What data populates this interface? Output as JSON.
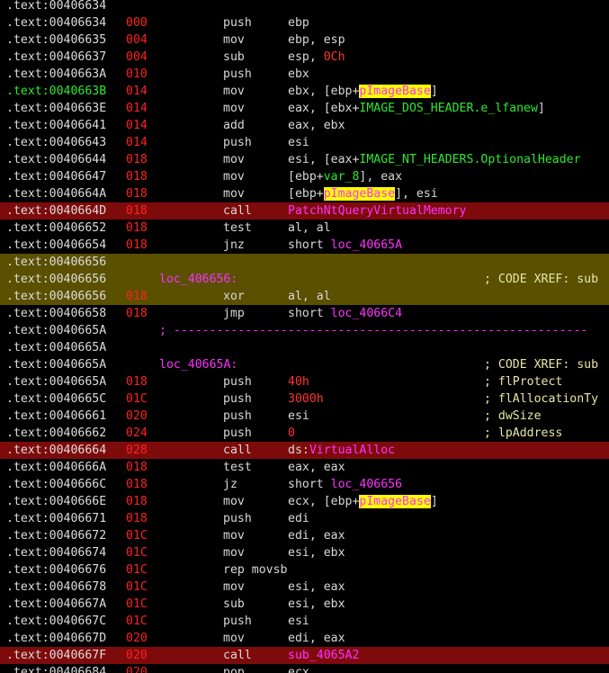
{
  "colors": {
    "background": "#000000",
    "call_highlight": "#7e0b0b",
    "selection_highlight": "#5a5000",
    "address_text": "#dcdcdc",
    "address_green": "#2ee82e",
    "stack_pointer": "#ff2020",
    "name_magenta": "#ff30ff",
    "comment_text": "#e6e6a6",
    "symbol_highlight": "#ffff00"
  },
  "lines": [
    {
      "addr": ".text:00406634",
      "sp": "",
      "mn": "",
      "opd": [],
      "comment": ""
    },
    {
      "addr": ".text:00406634",
      "sp": "000",
      "mn": "push",
      "opd": [
        [
          "ebp",
          ""
        ]
      ],
      "comment": ""
    },
    {
      "addr": ".text:00406635",
      "sp": "004",
      "mn": "mov",
      "opd": [
        [
          "ebp, esp",
          ""
        ]
      ],
      "comment": ""
    },
    {
      "addr": ".text:00406637",
      "sp": "004",
      "mn": "sub",
      "opd": [
        [
          "esp, ",
          ""
        ],
        [
          "0Ch",
          "num"
        ]
      ],
      "comment": ""
    },
    {
      "addr": ".text:0040663A",
      "sp": "010",
      "mn": "push",
      "opd": [
        [
          "ebx",
          ""
        ]
      ],
      "comment": ""
    },
    {
      "addr": ".text:0040663B",
      "addr_green": true,
      "sp": "014",
      "mn": "mov",
      "opd": [
        [
          "ebx, [ebp+",
          ""
        ],
        [
          "pImageBase",
          "hl"
        ],
        [
          "]",
          ""
        ]
      ],
      "comment": ""
    },
    {
      "addr": ".text:0040663E",
      "sp": "014",
      "mn": "mov",
      "opd": [
        [
          "eax, [ebx+",
          ""
        ],
        [
          "IMAGE_DOS_HEADER.e_lfanew",
          "grn"
        ],
        [
          "]",
          ""
        ]
      ],
      "comment": ""
    },
    {
      "addr": ".text:00406641",
      "sp": "014",
      "mn": "add",
      "opd": [
        [
          "eax, ebx",
          ""
        ]
      ],
      "comment": ""
    },
    {
      "addr": ".text:00406643",
      "sp": "014",
      "mn": "push",
      "opd": [
        [
          "esi",
          ""
        ]
      ],
      "comment": ""
    },
    {
      "addr": ".text:00406644",
      "sp": "018",
      "mn": "mov",
      "opd": [
        [
          "esi, [eax+",
          ""
        ],
        [
          "IMAGE_NT_HEADERS.OptionalHeader",
          "grn"
        ]
      ],
      "comment": ""
    },
    {
      "addr": ".text:00406647",
      "sp": "018",
      "mn": "mov",
      "opd": [
        [
          "[ebp+",
          ""
        ],
        [
          "var_8",
          "grn"
        ],
        [
          "], eax",
          ""
        ]
      ],
      "comment": ""
    },
    {
      "addr": ".text:0040664A",
      "sp": "018",
      "mn": "mov",
      "opd": [
        [
          "[ebp+",
          ""
        ],
        [
          "pImageBase",
          "hl"
        ],
        [
          "], esi",
          ""
        ]
      ],
      "comment": ""
    },
    {
      "addr": ".text:0040664D",
      "sp": "018",
      "mn": "call",
      "opd": [
        [
          "PatchNtQueryVirtualMemory",
          "name"
        ]
      ],
      "comment": "",
      "style": "call"
    },
    {
      "addr": ".text:00406652",
      "sp": "018",
      "mn": "test",
      "opd": [
        [
          "al, al",
          ""
        ]
      ],
      "comment": ""
    },
    {
      "addr": ".text:00406654",
      "sp": "018",
      "mn": "jnz",
      "opd": [
        [
          "short ",
          ""
        ],
        [
          "loc_40665A",
          "name"
        ]
      ],
      "comment": ""
    },
    {
      "addr": ".text:00406656",
      "sp": "",
      "mn": "",
      "opd": [],
      "comment": "",
      "style": "yellow"
    },
    {
      "addr": ".text:00406656",
      "sp": "",
      "mn": "",
      "opd": [],
      "label": "loc_406656:",
      "comment": "; CODE XREF: sub",
      "style": "yellow"
    },
    {
      "addr": ".text:00406656",
      "sp": "018",
      "mn": "xor",
      "opd": [
        [
          "al, al",
          ""
        ]
      ],
      "comment": "",
      "style": "yellow"
    },
    {
      "addr": ".text:00406658",
      "sp": "018",
      "mn": "jmp",
      "opd": [
        [
          "short ",
          ""
        ],
        [
          "loc_4066C4",
          "name"
        ]
      ],
      "comment": ""
    },
    {
      "addr": ".text:0040665A",
      "sp": "",
      "mn": "",
      "opd": [],
      "dashes": "; ----------------------------------------------------------",
      "comment": ""
    },
    {
      "addr": ".text:0040665A",
      "sp": "",
      "mn": "",
      "opd": [],
      "comment": ""
    },
    {
      "addr": ".text:0040665A",
      "sp": "",
      "mn": "",
      "opd": [],
      "label": "loc_40665A:",
      "comment": "; CODE XREF: sub"
    },
    {
      "addr": ".text:0040665A",
      "sp": "018",
      "mn": "push",
      "opd": [
        [
          "40h",
          "num"
        ]
      ],
      "comment": "; flProtect"
    },
    {
      "addr": ".text:0040665C",
      "sp": "01C",
      "mn": "push",
      "opd": [
        [
          "3000h",
          "num"
        ]
      ],
      "comment": "; flAllocationTy"
    },
    {
      "addr": ".text:00406661",
      "sp": "020",
      "mn": "push",
      "opd": [
        [
          "esi",
          ""
        ]
      ],
      "comment": "; dwSize"
    },
    {
      "addr": ".text:00406662",
      "sp": "024",
      "mn": "push",
      "opd": [
        [
          "0",
          "num"
        ]
      ],
      "comment": "; lpAddress"
    },
    {
      "addr": ".text:00406664",
      "sp": "028",
      "mn": "call",
      "opd": [
        [
          "ds:",
          ""
        ],
        [
          "VirtualAlloc",
          "name"
        ]
      ],
      "comment": "",
      "style": "call"
    },
    {
      "addr": ".text:0040666A",
      "sp": "018",
      "mn": "test",
      "opd": [
        [
          "eax, eax",
          ""
        ]
      ],
      "comment": ""
    },
    {
      "addr": ".text:0040666C",
      "sp": "018",
      "mn": "jz",
      "opd": [
        [
          "short ",
          ""
        ],
        [
          "loc_406656",
          "name"
        ]
      ],
      "comment": ""
    },
    {
      "addr": ".text:0040666E",
      "sp": "018",
      "mn": "mov",
      "opd": [
        [
          "ecx, [ebp+",
          ""
        ],
        [
          "pImageBase",
          "hl"
        ],
        [
          "]",
          ""
        ]
      ],
      "comment": ""
    },
    {
      "addr": ".text:00406671",
      "sp": "018",
      "mn": "push",
      "opd": [
        [
          "edi",
          ""
        ]
      ],
      "comment": ""
    },
    {
      "addr": ".text:00406672",
      "sp": "01C",
      "mn": "mov",
      "opd": [
        [
          "edi, eax",
          ""
        ]
      ],
      "comment": ""
    },
    {
      "addr": ".text:00406674",
      "sp": "01C",
      "mn": "mov",
      "opd": [
        [
          "esi, ebx",
          ""
        ]
      ],
      "comment": ""
    },
    {
      "addr": ".text:00406676",
      "sp": "01C",
      "mn": "rep movsb",
      "opd": [],
      "comment": ""
    },
    {
      "addr": ".text:00406678",
      "sp": "01C",
      "mn": "mov",
      "opd": [
        [
          "esi, eax",
          ""
        ]
      ],
      "comment": ""
    },
    {
      "addr": ".text:0040667A",
      "sp": "01C",
      "mn": "sub",
      "opd": [
        [
          "esi, ebx",
          ""
        ]
      ],
      "comment": ""
    },
    {
      "addr": ".text:0040667C",
      "sp": "01C",
      "mn": "push",
      "opd": [
        [
          "esi",
          ""
        ]
      ],
      "comment": ""
    },
    {
      "addr": ".text:0040667D",
      "sp": "020",
      "mn": "mov",
      "opd": [
        [
          "edi, eax",
          ""
        ]
      ],
      "comment": ""
    },
    {
      "addr": ".text:0040667F",
      "sp": "020",
      "mn": "call",
      "opd": [
        [
          "sub_4065A2",
          "name"
        ]
      ],
      "comment": "",
      "style": "call"
    },
    {
      "addr": ".text:00406684",
      "sp": "020",
      "mn": "pop",
      "opd": [
        [
          "ecx",
          ""
        ]
      ],
      "comment": ""
    }
  ]
}
